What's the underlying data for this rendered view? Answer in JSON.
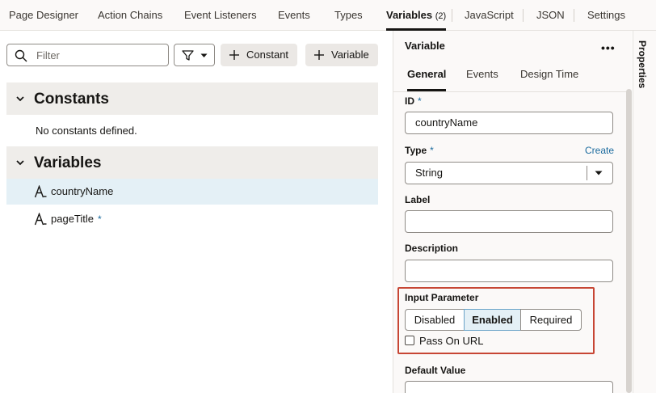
{
  "tabs": [
    {
      "label": "Page Designer"
    },
    {
      "label": "Action Chains"
    },
    {
      "label": "Event Listeners"
    },
    {
      "label": "Events"
    },
    {
      "label": "Types"
    },
    {
      "label": "Variables",
      "count": "(2)",
      "active": true
    },
    {
      "label": "JavaScript"
    },
    {
      "label": "JSON"
    },
    {
      "label": "Settings"
    }
  ],
  "toolbar": {
    "filter_placeholder": "Filter",
    "add_constant_label": "Constant",
    "add_variable_label": "Variable"
  },
  "constants": {
    "title": "Constants",
    "empty_text": "No constants defined."
  },
  "variables": {
    "title": "Variables",
    "items": [
      {
        "name": "countryName",
        "selected": true
      },
      {
        "name": "pageTitle",
        "required_mark": "*"
      }
    ]
  },
  "properties": {
    "title": "Variable",
    "more_icon": "more-icon",
    "tabs": [
      {
        "label": "General",
        "active": true
      },
      {
        "label": "Events"
      },
      {
        "label": "Design Time"
      }
    ],
    "id_label": "ID",
    "required_mark": "*",
    "id_value": "countryName",
    "type_label": "Type",
    "type_create_link": "Create",
    "type_value": "String",
    "label_label": "Label",
    "label_value": "",
    "description_label": "Description",
    "description_value": "",
    "input_parameter_label": "Input Parameter",
    "input_parameter_options": [
      "Disabled",
      "Enabled",
      "Required"
    ],
    "input_parameter_selected": "Enabled",
    "pass_on_url_label": "Pass On URL",
    "pass_on_url_checked": false,
    "default_value_label": "Default Value"
  },
  "side_panel": {
    "label": "Properties"
  },
  "colors": {
    "accent": "#1b6b9e",
    "highlight": "#c74634",
    "selected_row": "#e4f0f6"
  }
}
